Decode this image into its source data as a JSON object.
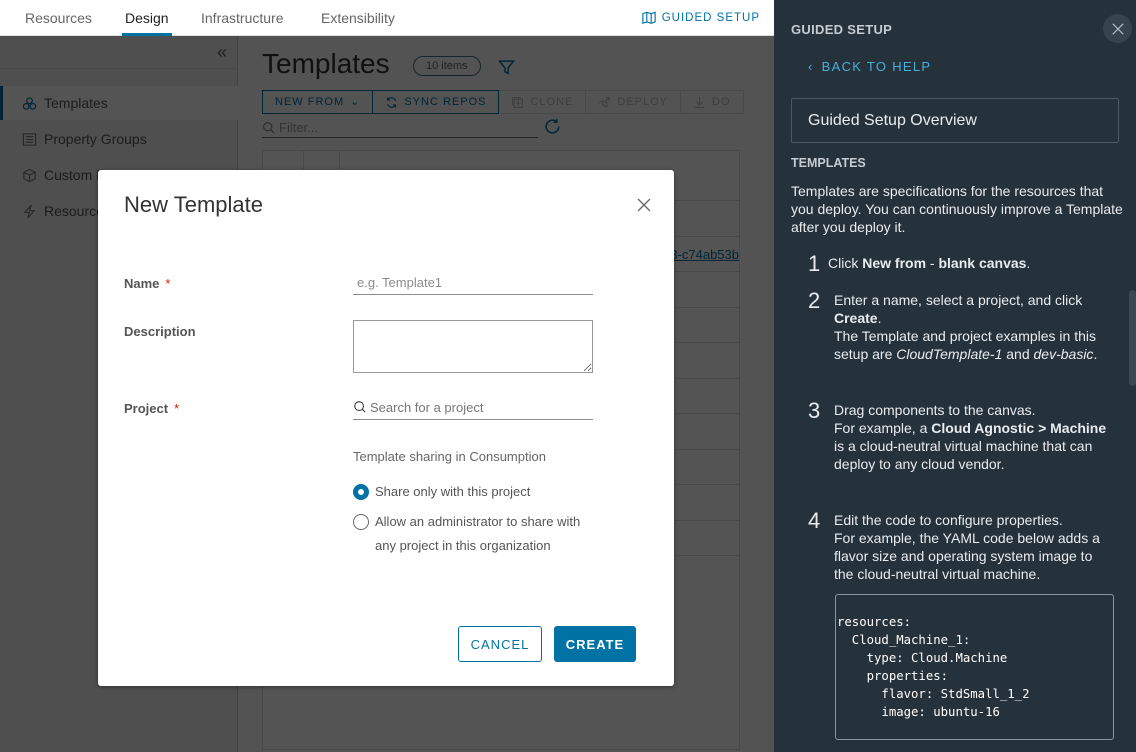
{
  "topnav": {
    "tabs": [
      {
        "label": "Resources",
        "active": false
      },
      {
        "label": "Design",
        "active": true
      },
      {
        "label": "Infrastructure",
        "active": false
      },
      {
        "label": "Extensibility",
        "active": false
      }
    ],
    "guided_setup_label": "GUIDED SETUP"
  },
  "sidebar": {
    "items": [
      {
        "label": "Templates",
        "icon": "templates-icon",
        "active": true
      },
      {
        "label": "Property Groups",
        "icon": "property-groups-icon",
        "active": false
      },
      {
        "label": "Custom Resources",
        "icon": "custom-resources-icon",
        "active": false
      },
      {
        "label": "Resource Actions",
        "icon": "resource-actions-icon",
        "active": false
      }
    ]
  },
  "main": {
    "title": "Templates",
    "count_badge": "10 items",
    "toolbar": {
      "new_from": "NEW FROM",
      "sync_repos": "SYNC REPOS",
      "clone": "CLONE",
      "deploy": "DEPLOY",
      "download": "DO"
    },
    "filter_placeholder": "Filter...",
    "grid_link_fragment": "3-c74ab53b"
  },
  "modal": {
    "title": "New Template",
    "name_label": "Name",
    "name_placeholder": "e.g. Template1",
    "description_label": "Description",
    "project_label": "Project",
    "project_placeholder": "Search for a project",
    "required_mark": "*",
    "sharing_label": "Template sharing in Consumption",
    "radio_options": [
      {
        "label": "Share only with this project",
        "checked": true
      },
      {
        "label": "Allow an administrator to share with any project in this organization",
        "checked": false
      }
    ],
    "cancel_label": "CANCEL",
    "create_label": "CREATE"
  },
  "guided_panel": {
    "heading": "GUIDED SETUP",
    "back_label": "BACK TO HELP",
    "overview_label": "Guided Setup Overview",
    "section_title": "TEMPLATES",
    "intro": "Templates are specifications for the resources that you deploy. You can continuously improve a Template after you deploy it.",
    "steps": [
      {
        "num": "1",
        "html": "Click <b>New from</b> - <b>blank canvas</b>."
      },
      {
        "num": "2",
        "html": "Enter a name, select a project, and click <b>Create</b>.<br>The Template and project examples in this setup are <i>CloudTemplate-1</i> and <i>dev-basic</i>."
      },
      {
        "num": "3",
        "html": "Drag components to the canvas.<br>For example, a <b>Cloud Agnostic &gt; Machine</b> is a cloud-neutral virtual machine that can deploy to any cloud vendor."
      },
      {
        "num": "4",
        "html": "Edit the code to configure properties.<br>For example, the YAML code below adds a flavor size and operating system image to the cloud-neutral virtual machine."
      }
    ],
    "code": "resources:\n  Cloud_Machine_1:\n    type: Cloud.Machine\n    properties:\n      flavor: StdSmall_1_2\n      image: ubuntu-16"
  },
  "colors": {
    "accent": "#0072a3",
    "panel_bg": "#25313b",
    "panel_link": "#49afd9",
    "required": "#c92100"
  }
}
